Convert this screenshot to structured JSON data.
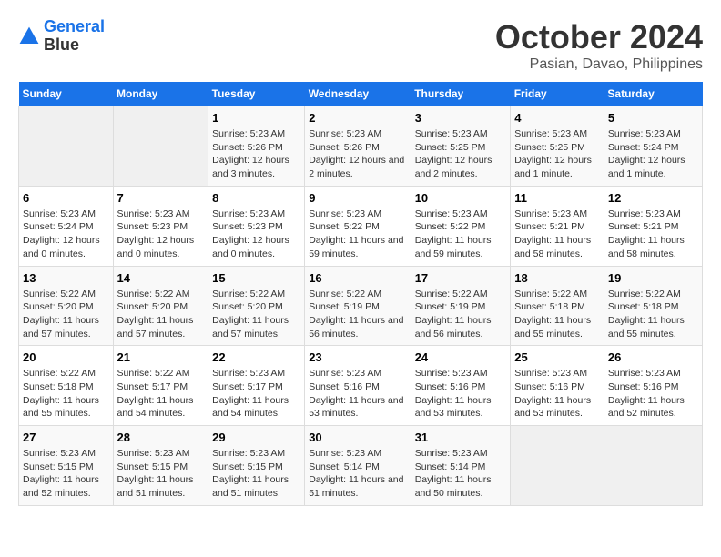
{
  "logo": {
    "line1": "General",
    "line2": "Blue"
  },
  "title": "October 2024",
  "subtitle": "Pasian, Davao, Philippines",
  "headers": [
    "Sunday",
    "Monday",
    "Tuesday",
    "Wednesday",
    "Thursday",
    "Friday",
    "Saturday"
  ],
  "weeks": [
    [
      {
        "day": "",
        "empty": true
      },
      {
        "day": "",
        "empty": true
      },
      {
        "day": "1",
        "sunrise": "Sunrise: 5:23 AM",
        "sunset": "Sunset: 5:26 PM",
        "daylight": "Daylight: 12 hours and 3 minutes."
      },
      {
        "day": "2",
        "sunrise": "Sunrise: 5:23 AM",
        "sunset": "Sunset: 5:26 PM",
        "daylight": "Daylight: 12 hours and 2 minutes."
      },
      {
        "day": "3",
        "sunrise": "Sunrise: 5:23 AM",
        "sunset": "Sunset: 5:25 PM",
        "daylight": "Daylight: 12 hours and 2 minutes."
      },
      {
        "day": "4",
        "sunrise": "Sunrise: 5:23 AM",
        "sunset": "Sunset: 5:25 PM",
        "daylight": "Daylight: 12 hours and 1 minute."
      },
      {
        "day": "5",
        "sunrise": "Sunrise: 5:23 AM",
        "sunset": "Sunset: 5:24 PM",
        "daylight": "Daylight: 12 hours and 1 minute."
      }
    ],
    [
      {
        "day": "6",
        "sunrise": "Sunrise: 5:23 AM",
        "sunset": "Sunset: 5:24 PM",
        "daylight": "Daylight: 12 hours and 0 minutes."
      },
      {
        "day": "7",
        "sunrise": "Sunrise: 5:23 AM",
        "sunset": "Sunset: 5:23 PM",
        "daylight": "Daylight: 12 hours and 0 minutes."
      },
      {
        "day": "8",
        "sunrise": "Sunrise: 5:23 AM",
        "sunset": "Sunset: 5:23 PM",
        "daylight": "Daylight: 12 hours and 0 minutes."
      },
      {
        "day": "9",
        "sunrise": "Sunrise: 5:23 AM",
        "sunset": "Sunset: 5:22 PM",
        "daylight": "Daylight: 11 hours and 59 minutes."
      },
      {
        "day": "10",
        "sunrise": "Sunrise: 5:23 AM",
        "sunset": "Sunset: 5:22 PM",
        "daylight": "Daylight: 11 hours and 59 minutes."
      },
      {
        "day": "11",
        "sunrise": "Sunrise: 5:23 AM",
        "sunset": "Sunset: 5:21 PM",
        "daylight": "Daylight: 11 hours and 58 minutes."
      },
      {
        "day": "12",
        "sunrise": "Sunrise: 5:23 AM",
        "sunset": "Sunset: 5:21 PM",
        "daylight": "Daylight: 11 hours and 58 minutes."
      }
    ],
    [
      {
        "day": "13",
        "sunrise": "Sunrise: 5:22 AM",
        "sunset": "Sunset: 5:20 PM",
        "daylight": "Daylight: 11 hours and 57 minutes."
      },
      {
        "day": "14",
        "sunrise": "Sunrise: 5:22 AM",
        "sunset": "Sunset: 5:20 PM",
        "daylight": "Daylight: 11 hours and 57 minutes."
      },
      {
        "day": "15",
        "sunrise": "Sunrise: 5:22 AM",
        "sunset": "Sunset: 5:20 PM",
        "daylight": "Daylight: 11 hours and 57 minutes."
      },
      {
        "day": "16",
        "sunrise": "Sunrise: 5:22 AM",
        "sunset": "Sunset: 5:19 PM",
        "daylight": "Daylight: 11 hours and 56 minutes."
      },
      {
        "day": "17",
        "sunrise": "Sunrise: 5:22 AM",
        "sunset": "Sunset: 5:19 PM",
        "daylight": "Daylight: 11 hours and 56 minutes."
      },
      {
        "day": "18",
        "sunrise": "Sunrise: 5:22 AM",
        "sunset": "Sunset: 5:18 PM",
        "daylight": "Daylight: 11 hours and 55 minutes."
      },
      {
        "day": "19",
        "sunrise": "Sunrise: 5:22 AM",
        "sunset": "Sunset: 5:18 PM",
        "daylight": "Daylight: 11 hours and 55 minutes."
      }
    ],
    [
      {
        "day": "20",
        "sunrise": "Sunrise: 5:22 AM",
        "sunset": "Sunset: 5:18 PM",
        "daylight": "Daylight: 11 hours and 55 minutes."
      },
      {
        "day": "21",
        "sunrise": "Sunrise: 5:22 AM",
        "sunset": "Sunset: 5:17 PM",
        "daylight": "Daylight: 11 hours and 54 minutes."
      },
      {
        "day": "22",
        "sunrise": "Sunrise: 5:23 AM",
        "sunset": "Sunset: 5:17 PM",
        "daylight": "Daylight: 11 hours and 54 minutes."
      },
      {
        "day": "23",
        "sunrise": "Sunrise: 5:23 AM",
        "sunset": "Sunset: 5:16 PM",
        "daylight": "Daylight: 11 hours and 53 minutes."
      },
      {
        "day": "24",
        "sunrise": "Sunrise: 5:23 AM",
        "sunset": "Sunset: 5:16 PM",
        "daylight": "Daylight: 11 hours and 53 minutes."
      },
      {
        "day": "25",
        "sunrise": "Sunrise: 5:23 AM",
        "sunset": "Sunset: 5:16 PM",
        "daylight": "Daylight: 11 hours and 53 minutes."
      },
      {
        "day": "26",
        "sunrise": "Sunrise: 5:23 AM",
        "sunset": "Sunset: 5:16 PM",
        "daylight": "Daylight: 11 hours and 52 minutes."
      }
    ],
    [
      {
        "day": "27",
        "sunrise": "Sunrise: 5:23 AM",
        "sunset": "Sunset: 5:15 PM",
        "daylight": "Daylight: 11 hours and 52 minutes."
      },
      {
        "day": "28",
        "sunrise": "Sunrise: 5:23 AM",
        "sunset": "Sunset: 5:15 PM",
        "daylight": "Daylight: 11 hours and 51 minutes."
      },
      {
        "day": "29",
        "sunrise": "Sunrise: 5:23 AM",
        "sunset": "Sunset: 5:15 PM",
        "daylight": "Daylight: 11 hours and 51 minutes."
      },
      {
        "day": "30",
        "sunrise": "Sunrise: 5:23 AM",
        "sunset": "Sunset: 5:14 PM",
        "daylight": "Daylight: 11 hours and 51 minutes."
      },
      {
        "day": "31",
        "sunrise": "Sunrise: 5:23 AM",
        "sunset": "Sunset: 5:14 PM",
        "daylight": "Daylight: 11 hours and 50 minutes."
      },
      {
        "day": "",
        "empty": true
      },
      {
        "day": "",
        "empty": true
      }
    ]
  ]
}
